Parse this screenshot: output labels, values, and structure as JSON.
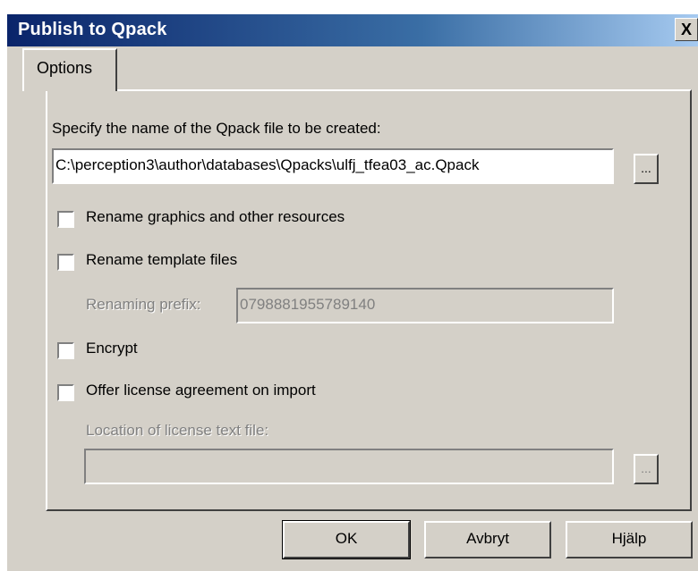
{
  "window": {
    "title": "Publish to Qpack",
    "close_glyph": "X"
  },
  "tabs": [
    {
      "label": "Options"
    }
  ],
  "form": {
    "file_label": "Specify the name of the Qpack file to be created:",
    "file_path": "C:\\perception3\\author\\databases\\Qpacks\\ulfj_tfea03_ac.Qpack",
    "browse_label": "...",
    "rename_graphics": {
      "label": "Rename graphics and other resources",
      "checked": false
    },
    "rename_templates": {
      "label": "Rename template files",
      "checked": false
    },
    "prefix_label": "Renaming prefix:",
    "prefix_value": "0798881955789140",
    "encrypt": {
      "label": "Encrypt",
      "checked": false
    },
    "offer_license": {
      "label": "Offer license agreement on import",
      "checked": false
    },
    "license_label": "Location of license text file:",
    "license_value": ""
  },
  "buttons": {
    "ok": "OK",
    "cancel": "Avbryt",
    "help": "Hjälp"
  },
  "colors": {
    "face": "#d4d0c8",
    "title_start": "#0a246a",
    "title_end": "#a6caf0"
  }
}
